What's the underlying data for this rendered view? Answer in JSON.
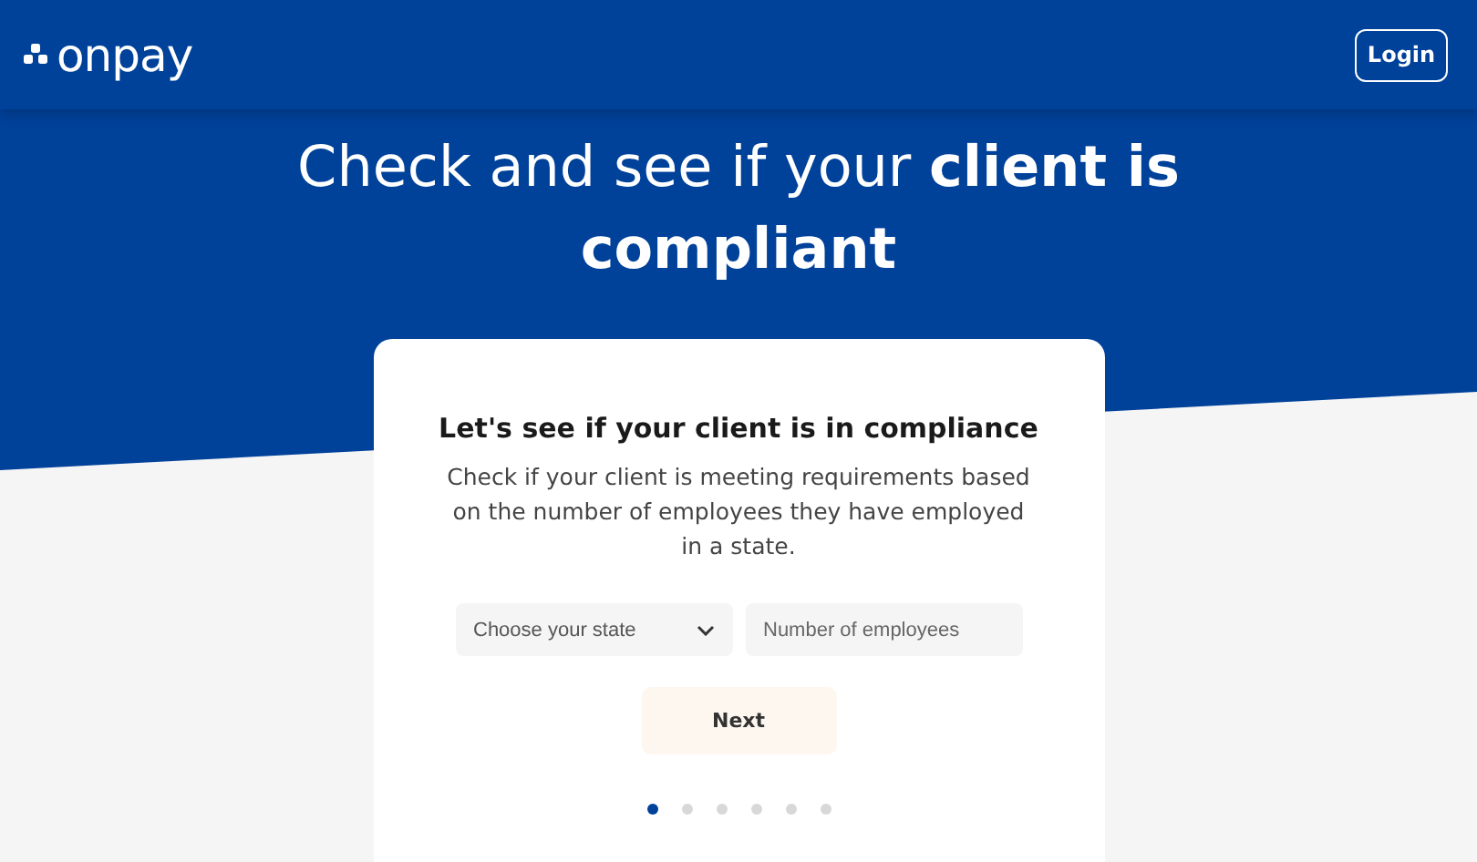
{
  "header": {
    "logo": "onpay",
    "login_button": "Login"
  },
  "hero": {
    "title": "Check and see if your **client is compliant**"
  },
  "card": {
    "heading": "Let's see if your client is in compliance",
    "description": "Check if your client is meeting requirements based on the number of employees they have employed in a state.",
    "state_select": {
      "placeholder": "Choose your state"
    },
    "employees_field": {
      "placeholder": "Number of employees"
    },
    "next_button": "Next",
    "steps": [
      {
        "selected": true
      },
      {
        "selected": false
      },
      {
        "selected": false
      },
      {
        "selected": false
      },
      {
        "selected": false
      },
      {
        "selected": false
      }
    ]
  }
}
